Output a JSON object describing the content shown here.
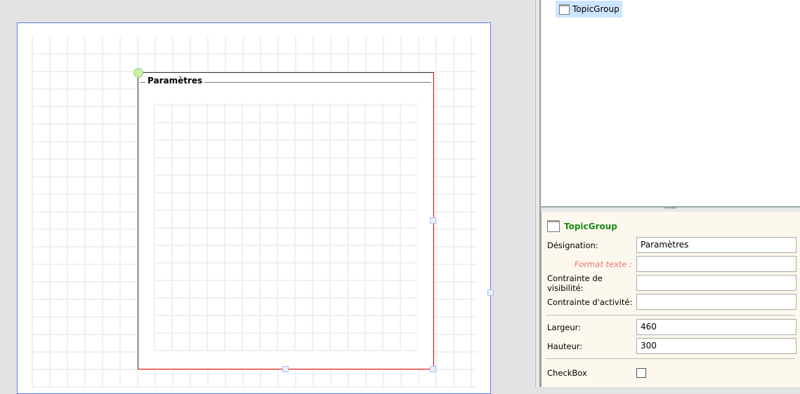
{
  "designer": {
    "group_title": "Paramètres"
  },
  "tree": {
    "items": [
      {
        "label": "TopicGroup",
        "icon": "window-icon",
        "selected": true
      }
    ]
  },
  "properties": {
    "title": "TopicGroup",
    "designation_label": "Désignation:",
    "designation_value": "Paramètres",
    "format_label": "Format texte :",
    "format_value": "",
    "visibility_label": "Contrainte de visibilité:",
    "visibility_value": "",
    "activity_label": "Contrainte d'activité:",
    "activity_value": "",
    "width_label": "Largeur:",
    "width_value": "460",
    "height_label": "Hauteur:",
    "height_value": "300",
    "checkbox_label": "CheckBox",
    "checkbox_checked": false
  }
}
